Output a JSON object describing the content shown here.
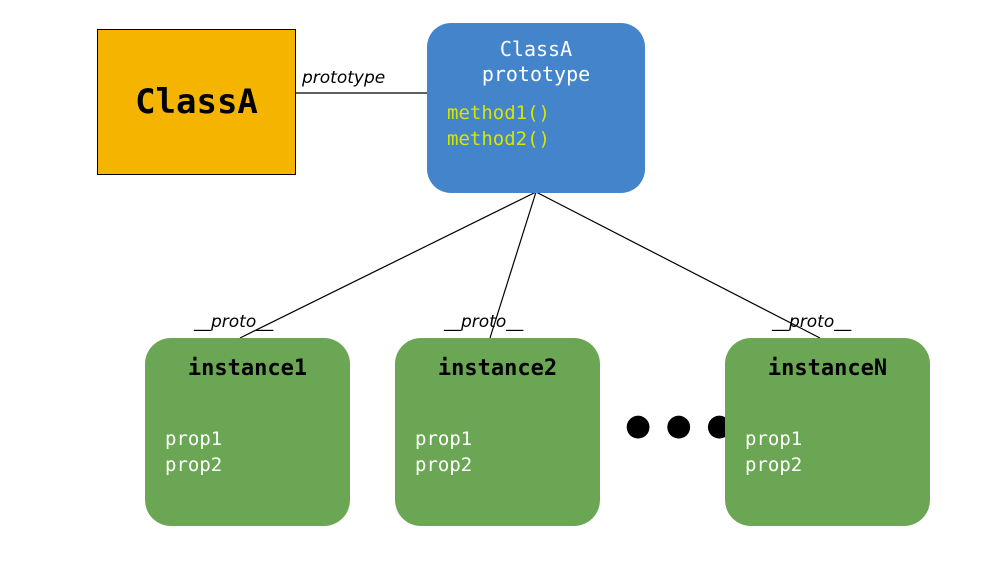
{
  "classBox": {
    "label": "ClassA"
  },
  "protoEdge": {
    "label": "prototype"
  },
  "protoBox": {
    "title": "ClassA\nprototype",
    "methods": [
      "method1()",
      "method2()"
    ]
  },
  "instanceEdgeLabel": "__proto__",
  "instances": [
    {
      "name": "instance1",
      "props": [
        "prop1",
        "prop2"
      ]
    },
    {
      "name": "instance2",
      "props": [
        "prop1",
        "prop2"
      ]
    },
    {
      "name": "instanceN",
      "props": [
        "prop1",
        "prop2"
      ]
    }
  ],
  "ellipsis": "● ● ●"
}
